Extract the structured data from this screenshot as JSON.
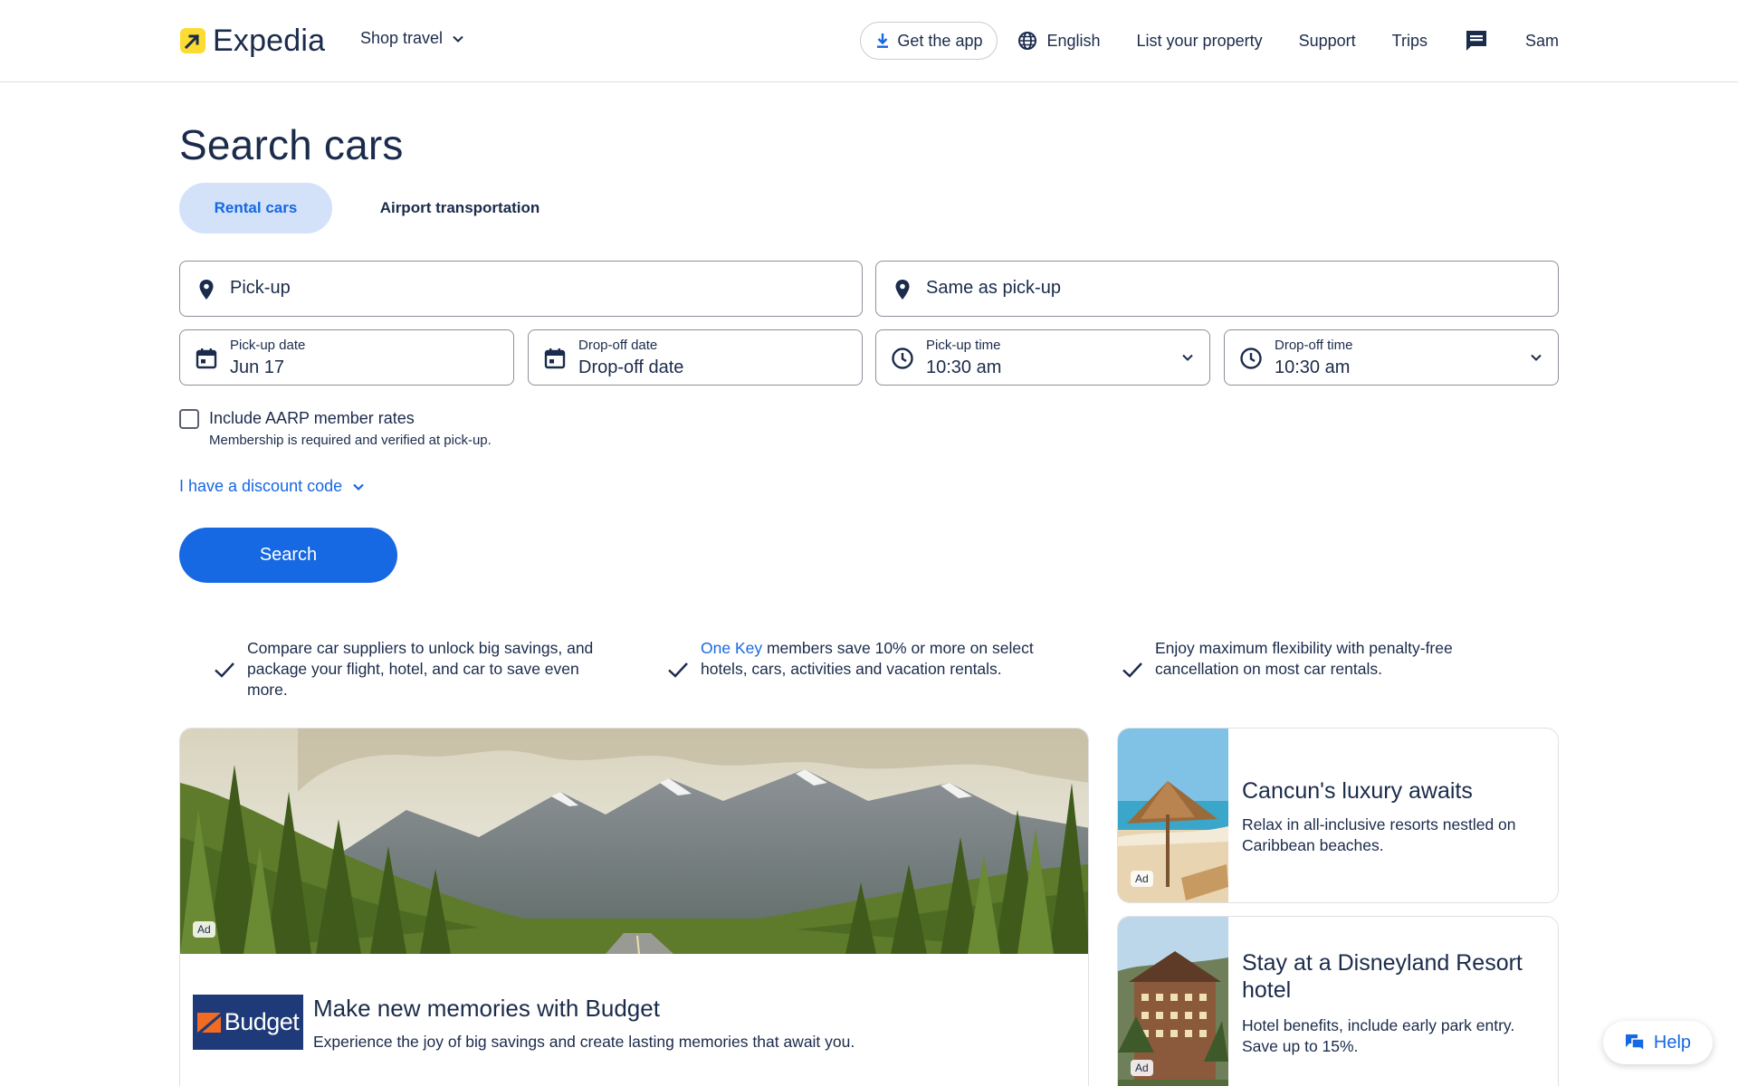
{
  "header": {
    "logo_text": "Expedia",
    "shop_travel": "Shop travel",
    "get_app": "Get the app",
    "language": "English",
    "list_property": "List your property",
    "support": "Support",
    "trips": "Trips",
    "user": "Sam"
  },
  "page_title": "Search cars",
  "tabs": [
    {
      "label": "Rental cars",
      "selected": true
    },
    {
      "label": "Airport transportation",
      "selected": false
    }
  ],
  "search_form": {
    "pickup_location_placeholder": "Pick-up",
    "dropoff_location_placeholder": "Same as pick-up",
    "pickup_date": {
      "label": "Pick-up date",
      "value": "Jun 17"
    },
    "dropoff_date": {
      "label": "Drop-off date",
      "value": "Drop-off date"
    },
    "pickup_time": {
      "label": "Pick-up time",
      "value": "10:30 am"
    },
    "dropoff_time": {
      "label": "Drop-off time",
      "value": "10:30 am"
    },
    "aarp_label": "Include AARP member rates",
    "aarp_note": "Membership is required and verified at pick-up.",
    "aarp_checked": false,
    "discount_code": "I have a discount code",
    "search_button": "Search"
  },
  "benefits": [
    {
      "text": "Compare car suppliers to unlock big savings, and package your flight, hotel, and car to save even more."
    },
    {
      "link": "One Key",
      "text": " members save 10% or more on select hotels, cars, activities and vacation rentals."
    },
    {
      "text": "Enjoy maximum flexibility with penalty-free cancellation on most car rentals."
    }
  ],
  "main_card": {
    "ad_label": "Ad",
    "logo_text": "Budget",
    "title": "Make new memories with Budget",
    "subtitle": "Experience the joy of big savings and create lasting memories that await you."
  },
  "side_cards": [
    {
      "ad_label": "Ad",
      "title": "Cancun's luxury awaits",
      "subtitle": "Relax in all-inclusive resorts nestled on Caribbean beaches."
    },
    {
      "ad_label": "Ad",
      "title": "Stay at a Disneyland Resort hotel",
      "subtitle": "Hotel benefits, include early park entry. Save up to 15%."
    }
  ],
  "help_button": "Help",
  "colors": {
    "brand_blue": "#1668e3",
    "navy": "#1b2b4b",
    "tab_selected_bg": "#d3e2f8",
    "logo_yellow": "#fddb32",
    "budget_blue": "#1f3a78",
    "budget_orange": "#f26b21"
  }
}
